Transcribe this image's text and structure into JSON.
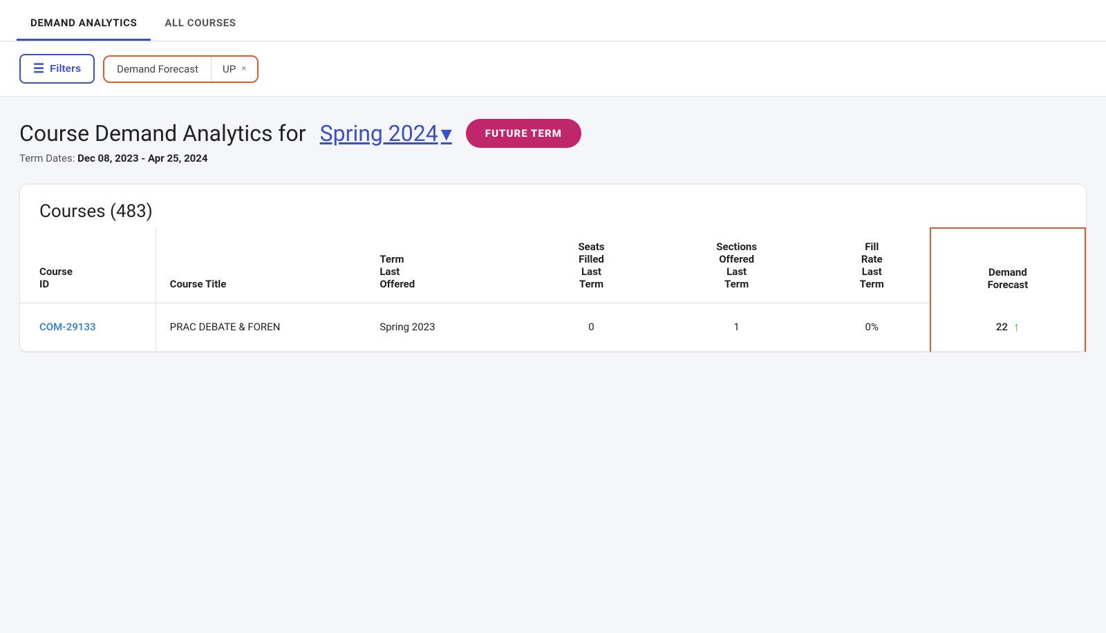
{
  "nav": {
    "tabs": [
      {
        "id": "demand-analytics",
        "label": "DEMAND ANALYTICS",
        "active": true
      },
      {
        "id": "all-courses",
        "label": "ALL COURSES",
        "active": false
      }
    ]
  },
  "filterBar": {
    "filtersButton": "Filters",
    "filterIcon": "≡",
    "chip": {
      "label": "Demand Forecast",
      "value": "UP",
      "closeIcon": "×"
    }
  },
  "pageHeading": {
    "prefix": "Course Demand Analytics for",
    "term": "Spring 2024",
    "chevron": "▾",
    "futureTerm": "FUTURE TERM",
    "termDatesLabel": "Term Dates:",
    "termDates": "Dec 08, 2023 - Apr 25, 2024"
  },
  "coursesTable": {
    "title": "Courses (483)",
    "columns": {
      "courseId": {
        "line1": "Course",
        "line2": "ID"
      },
      "courseTitle": "Course Title",
      "termLastOffered": {
        "line1": "Term",
        "line2": "Last",
        "line3": "Offered"
      },
      "seatsFilledLastTerm": {
        "line1": "Seats",
        "line2": "Filled",
        "line3": "Last",
        "line4": "Term"
      },
      "sectionsOfferedLastTerm": {
        "line1": "Sections",
        "line2": "Offered",
        "line3": "Last",
        "line4": "Term"
      },
      "fillRateLastTerm": {
        "line1": "Fill",
        "line2": "Rate",
        "line3": "Last",
        "line4": "Term"
      },
      "demandForecast": {
        "line1": "Demand",
        "line2": "Forecast"
      }
    },
    "rows": [
      {
        "courseId": "COM-29133",
        "courseTitle": "PRAC DEBATE & FOREN",
        "termLastOffered": "Spring 2023",
        "seatsFilledLastTerm": "0",
        "sectionsOfferedLastTerm": "1",
        "fillRateLastTerm": "0%",
        "demandForecast": "22",
        "demandTrend": "up"
      }
    ]
  }
}
